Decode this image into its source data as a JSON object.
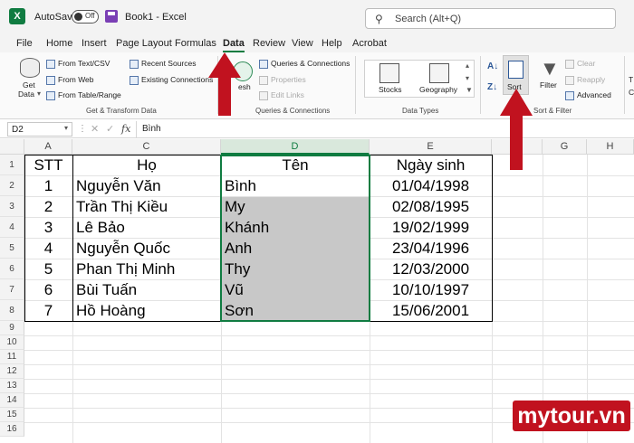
{
  "titlebar": {
    "autosave_label": "AutoSave",
    "autosave_state": "Off",
    "doc_title": "Book1  -  Excel",
    "search_placeholder": "Search (Alt+Q)"
  },
  "menu": {
    "tabs": [
      "File",
      "Home",
      "Insert",
      "Page Layout",
      "Formulas",
      "Data",
      "Review",
      "View",
      "Help",
      "Acrobat"
    ],
    "active": "Data"
  },
  "ribbon": {
    "get_data_line1": "Get",
    "get_data_line2": "Data",
    "from_text_csv": "From Text/CSV",
    "from_web": "From Web",
    "from_table_range": "From Table/Range",
    "recent_sources": "Recent Sources",
    "existing_connections": "Existing Connections",
    "refresh_label": "esh",
    "queries_connections": "Queries & Connections",
    "properties": "Properties",
    "edit_links": "Edit Links",
    "stocks": "Stocks",
    "geography": "Geography",
    "sort": "Sort",
    "filter": "Filter",
    "clear": "Clear",
    "reapply": "Reapply",
    "advanced": "Advanced",
    "group_get_transform": "Get & Transform Data",
    "group_queries": "Queries & Connections",
    "group_data_types": "Data Types",
    "group_sort_filter": "Sort & Filter",
    "edge_t": "T",
    "edge_c": "C"
  },
  "formula_bar": {
    "name_box": "D2",
    "formula": "Bình",
    "fx": "fx"
  },
  "columns": [
    "A",
    "C",
    "D",
    "E",
    "G",
    "H"
  ],
  "rows": [
    "1",
    "2",
    "3",
    "4",
    "5",
    "6",
    "7",
    "8",
    "9",
    "10",
    "11",
    "12",
    "13",
    "14",
    "15",
    "16"
  ],
  "table": {
    "headers": [
      "STT",
      "Họ",
      "Tên",
      "Ngày sinh"
    ],
    "rows": [
      [
        "1",
        "Nguyễn Văn",
        "Bình",
        "01/04/1998"
      ],
      [
        "2",
        "Trần Thị Kiều",
        "My",
        "02/08/1995"
      ],
      [
        "3",
        "Lê Bảo",
        "Khánh",
        "19/02/1999"
      ],
      [
        "4",
        "Nguyễn Quốc",
        "Anh",
        "23/04/1996"
      ],
      [
        "5",
        "Phan Thị Minh",
        "Thy",
        "12/03/2000"
      ],
      [
        "6",
        "Bùi Tuấn",
        "Vũ",
        "10/10/1997"
      ],
      [
        "7",
        "Hồ Hoàng",
        "Sơn",
        "15/06/2001"
      ]
    ]
  },
  "watermark": "mytour.vn",
  "colors": {
    "excel_green": "#107c41",
    "arrow_red": "#c1121f",
    "selection_gray": "#c8c8c8"
  }
}
